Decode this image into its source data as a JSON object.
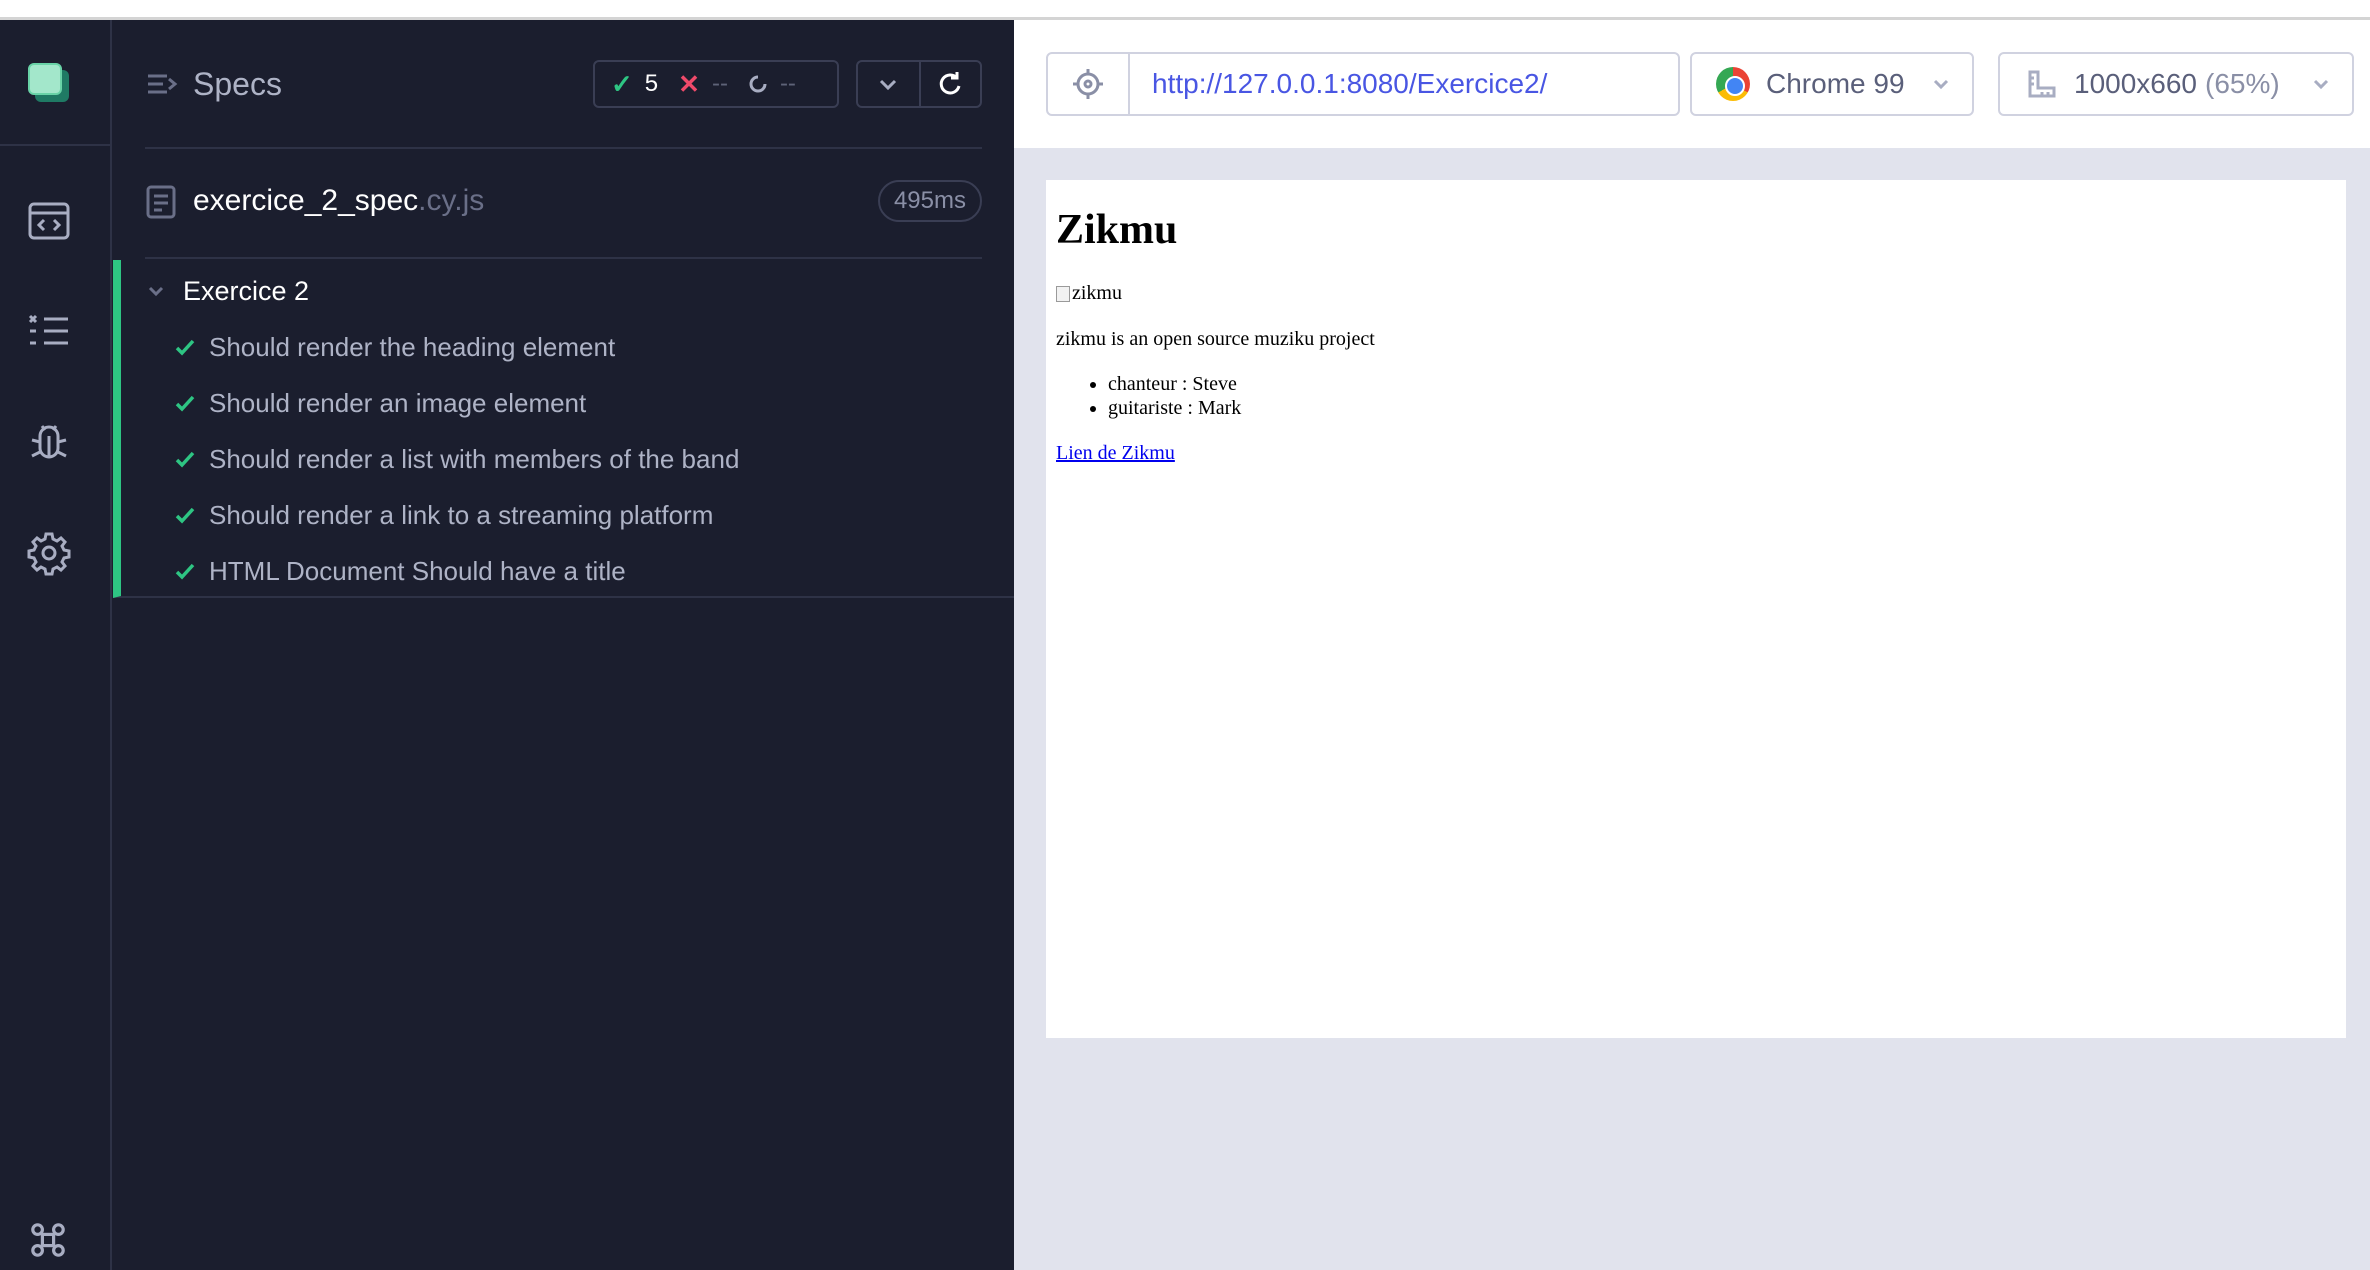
{
  "runner": {
    "specs_label": "Specs",
    "stats": {
      "passed": "5",
      "failed": "--",
      "pending": "--"
    },
    "spec_file": {
      "name": "exercice_2_spec",
      "ext": ".cy.js",
      "duration": "495ms"
    },
    "suite": {
      "title": "Exercice 2",
      "tests": [
        "Should render the heading element",
        "Should render an image element",
        "Should render a list with members of the band",
        "Should render a link to a streaming platform",
        "HTML Document Should have a title"
      ]
    }
  },
  "preview": {
    "url": "http://127.0.0.1:8080/Exercice2/",
    "browser": "Chrome 99",
    "viewport": "1000x660",
    "scale": "(65%)"
  },
  "aut": {
    "heading": "Zikmu",
    "image_alt": "zikmu",
    "description": "zikmu is an open source muziku project",
    "members": [
      "chanteur : Steve",
      "guitariste : Mark"
    ],
    "link": "Lien de Zikmu"
  },
  "colors": {
    "background": "#1b1e2e",
    "pass": "#2ec583",
    "fail": "#f04a6a",
    "url": "#4956e3"
  }
}
